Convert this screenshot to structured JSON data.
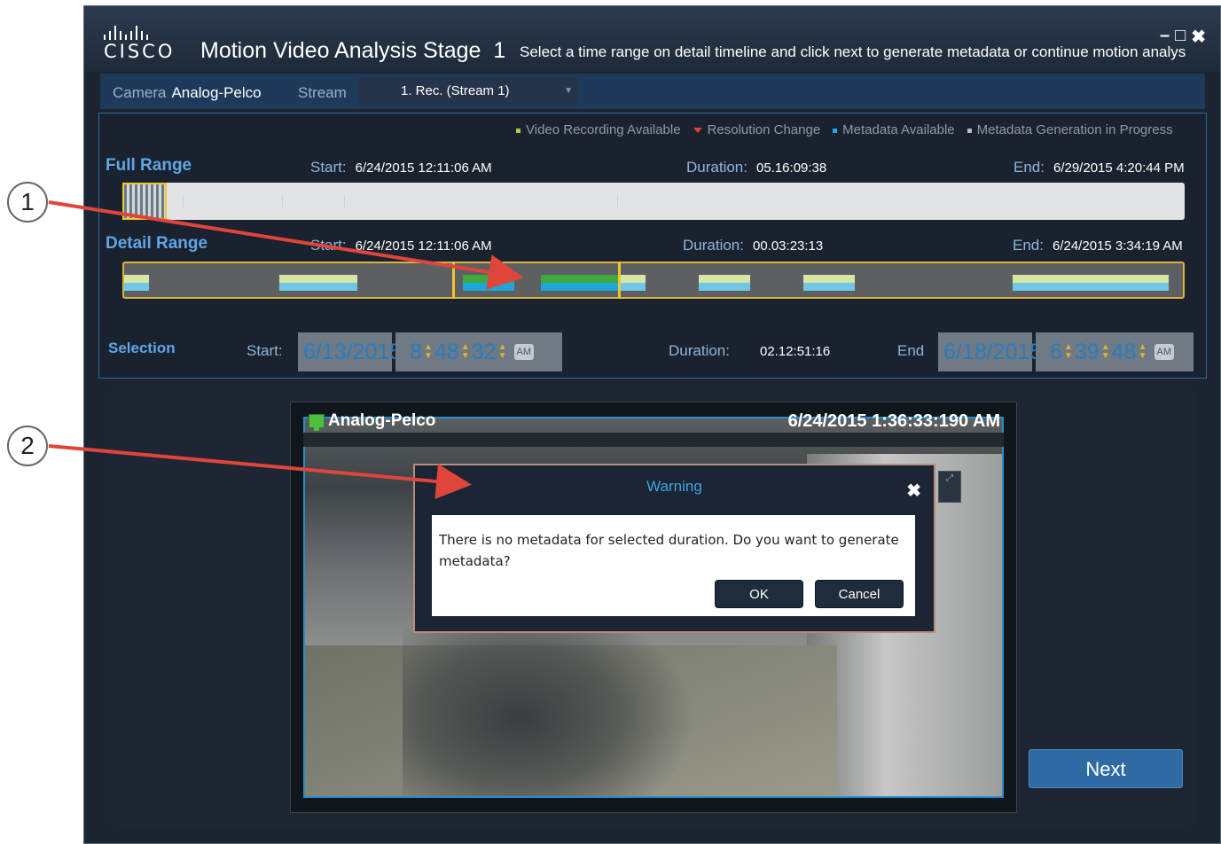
{
  "window": {
    "logo": "CISCO",
    "title": "Motion Video Analysis Stage",
    "stage_number": "1",
    "subtitle": "Select a time range on detail timeline and click next to generate metadata or continue motion analys"
  },
  "camera_row": {
    "camera_label": "Camera",
    "camera_value": "Analog-Pelco",
    "stream_label": "Stream",
    "stream_value": "1. Rec. (Stream 1)"
  },
  "legend": [
    {
      "label": "Video Recording Available",
      "color": "#b4c83a"
    },
    {
      "label": "Resolution Change",
      "color": "#d8443b"
    },
    {
      "label": "Metadata Available",
      "color": "#2ea6e0"
    },
    {
      "label": "Metadata Generation in Progress",
      "color": "#b8bec4"
    }
  ],
  "full_range": {
    "label": "Full Range",
    "start_label": "Start:",
    "start": "6/24/2015 12:11:06 AM",
    "duration_label": "Duration:",
    "duration": "05.16:09:38",
    "end_label": "End:",
    "end": "6/29/2015 4:20:44 PM"
  },
  "detail_range": {
    "label": "Detail Range",
    "start_label": "Start:",
    "start": "6/24/2015 12:11:06 AM",
    "duration_label": "Duration:",
    "duration": "00.03:23:13",
    "end_label": "End:",
    "end": "6/24/2015 3:34:19 AM"
  },
  "selection": {
    "label": "Selection",
    "start_label": "Start:",
    "start_date": "6/13/2015",
    "start_hour": "8",
    "start_min": "48",
    "start_sec": "32",
    "start_ampm": "AM",
    "duration_label": "Duration:",
    "duration": "02.12:51:16",
    "end_label": "End",
    "end_date": "6/18/2015",
    "end_hour": "6",
    "end_min": "39",
    "end_sec": "48",
    "end_ampm": "AM"
  },
  "video": {
    "camera_name": "Analog-Pelco",
    "timestamp": "6/24/2015 1:36:33:190 AM"
  },
  "dialog": {
    "title": "Warning",
    "message": "There is no metadata for selected duration. Do you want to generate metadata?",
    "ok_label": "OK",
    "cancel_label": "Cancel"
  },
  "next_label": "Next",
  "callouts": [
    "1",
    "2"
  ],
  "accent_colors": {
    "highlight": "#f0c52c",
    "link": "#5fa6e6",
    "arrow": "#e0453c"
  }
}
